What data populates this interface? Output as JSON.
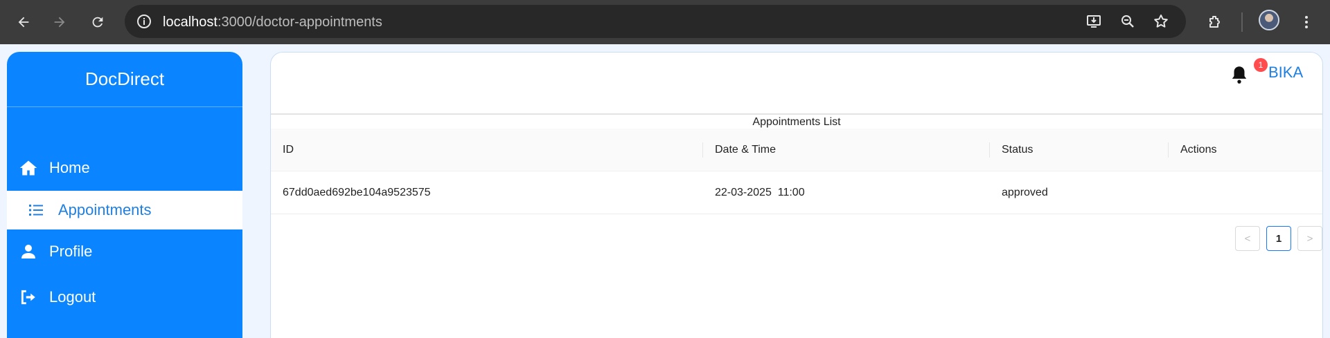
{
  "browser": {
    "url_host": "localhost",
    "url_path": ":3000/doctor-appointments",
    "icons": [
      "back-icon",
      "forward-icon",
      "reload-icon",
      "site-info-icon",
      "install-icon",
      "zoom-out-icon",
      "bookmark-star-icon",
      "extensions-icon",
      "profile-avatar",
      "kebab-menu-icon"
    ]
  },
  "sidebar": {
    "brand": "DocDirect",
    "items": [
      {
        "label": "Home",
        "icon": "home-icon"
      },
      {
        "label": "Appointments",
        "icon": "list-icon",
        "active": true
      },
      {
        "label": "Profile",
        "icon": "user-icon"
      },
      {
        "label": "Logout",
        "icon": "logout-icon"
      }
    ]
  },
  "header": {
    "notification_count": "1",
    "user_name": "BIKA"
  },
  "table": {
    "caption": "Appointments List",
    "columns": [
      "ID",
      "Date & Time",
      "Status",
      "Actions"
    ],
    "rows": [
      {
        "id": "67dd0aed692be104a9523575",
        "datetime": "22-03-2025  11:00",
        "status": "approved",
        "actions": ""
      }
    ]
  },
  "pagination": {
    "prev": "<",
    "current_page": "1",
    "next": ">"
  },
  "colors": {
    "sidebar_blue": "#0a85ff",
    "accent_text": "#1f7fe0",
    "badge_red": "#ff4d4f"
  }
}
